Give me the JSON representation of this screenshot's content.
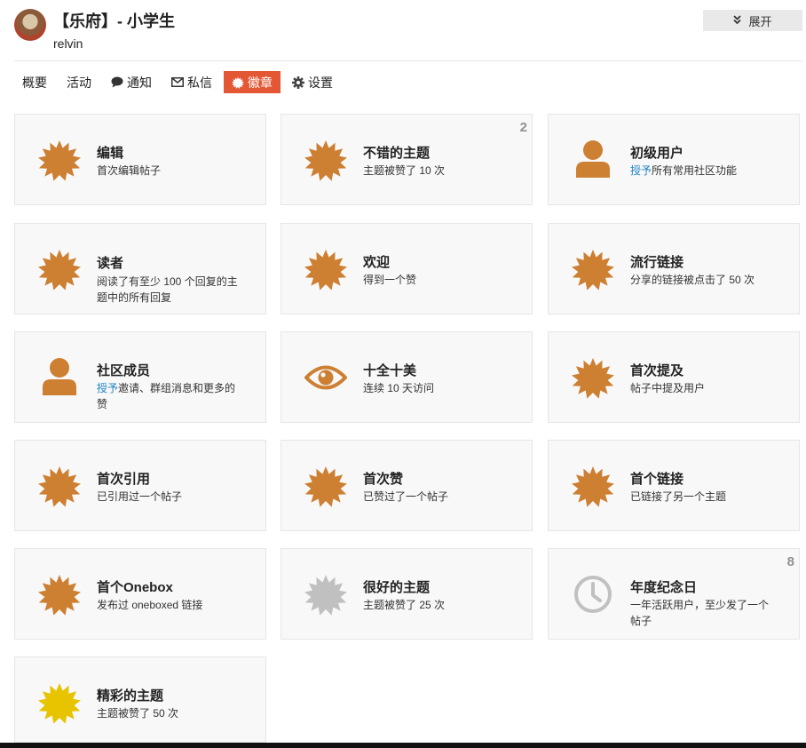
{
  "header": {
    "title": "【乐府】- 小学生",
    "username": "relvin",
    "expand_label": "展开",
    "expand_icon": "double-chevron-down-icon"
  },
  "nav": {
    "items": [
      {
        "label": "概要",
        "icon": ""
      },
      {
        "label": "活动",
        "icon": ""
      },
      {
        "label": "通知",
        "icon": "comment-icon"
      },
      {
        "label": "私信",
        "icon": "envelope-icon"
      },
      {
        "label": "徽章",
        "icon": "badge-icon",
        "active": true
      },
      {
        "label": "设置",
        "icon": "gear-icon"
      }
    ]
  },
  "colors": {
    "bronze": "#cd7f32",
    "silver": "#c0c0c0",
    "gold": "#e7c300",
    "accent": "#e45735",
    "link": "#2083c4"
  },
  "badges": [
    {
      "name": "编辑",
      "desc": "首次编辑帖子",
      "icon": "certificate-icon",
      "tier": "bronze"
    },
    {
      "name": "不错的主题",
      "desc": "主题被赞了 10 次",
      "icon": "certificate-icon",
      "tier": "bronze",
      "count": "2"
    },
    {
      "name": "初级用户",
      "desc_link": "授予",
      "desc": "所有常用社区功能",
      "icon": "user-icon",
      "tier": "bronze"
    },
    {
      "name": "读者",
      "desc": "阅读了有至少 100 个回复的主题中的所有回复",
      "icon": "certificate-icon",
      "tier": "bronze"
    },
    {
      "name": "欢迎",
      "desc": "得到一个赞",
      "icon": "certificate-icon",
      "tier": "bronze"
    },
    {
      "name": "流行链接",
      "desc": "分享的链接被点击了 50 次",
      "icon": "certificate-icon",
      "tier": "bronze"
    },
    {
      "name": "社区成员",
      "desc_link": "授予",
      "desc": "邀请、群组消息和更多的赞",
      "icon": "user-icon",
      "tier": "bronze"
    },
    {
      "name": "十全十美",
      "desc": "连续 10 天访问",
      "icon": "eye-icon",
      "tier": "bronze"
    },
    {
      "name": "首次提及",
      "desc": "帖子中提及用户",
      "icon": "certificate-icon",
      "tier": "bronze"
    },
    {
      "name": "首次引用",
      "desc": "已引用过一个帖子",
      "icon": "certificate-icon",
      "tier": "bronze"
    },
    {
      "name": "首次赞",
      "desc": "已赞过了一个帖子",
      "icon": "certificate-icon",
      "tier": "bronze"
    },
    {
      "name": "首个链接",
      "desc": "已链接了另一个主题",
      "icon": "certificate-icon",
      "tier": "bronze"
    },
    {
      "name": "首个Onebox",
      "desc": "发布过 oneboxed 链接",
      "icon": "certificate-icon",
      "tier": "bronze"
    },
    {
      "name": "很好的主题",
      "desc": "主题被赞了 25 次",
      "icon": "certificate-icon",
      "tier": "silver"
    },
    {
      "name": "年度纪念日",
      "desc": "一年活跃用户，至少发了一个帖子",
      "icon": "clock-icon",
      "tier": "silver",
      "count": "8"
    },
    {
      "name": "精彩的主题",
      "desc": "主题被赞了 50 次",
      "icon": "certificate-icon",
      "tier": "gold"
    }
  ]
}
